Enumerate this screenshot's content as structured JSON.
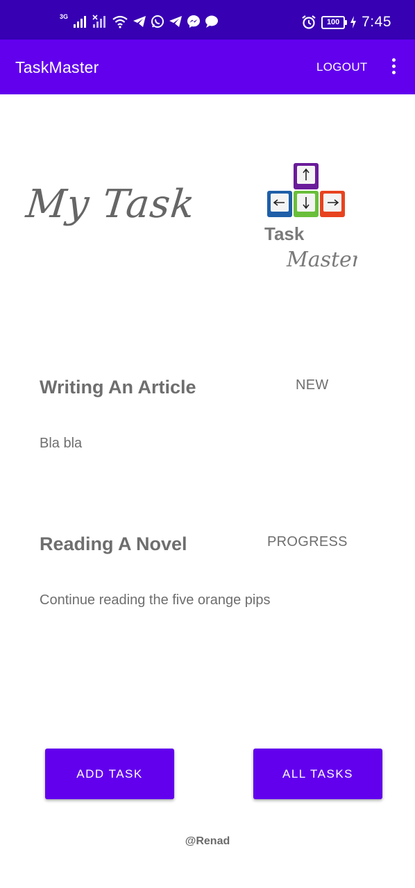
{
  "status_bar": {
    "network_label": "3G",
    "battery": "100",
    "time": "7:45",
    "icons": [
      "signal-icon",
      "no-signal-icon",
      "wifi-icon",
      "telegram-icon",
      "whatsapp-icon",
      "telegram-icon",
      "messenger-icon",
      "chat-icon",
      "alarm-icon",
      "battery-icon",
      "charging-icon"
    ]
  },
  "app_bar": {
    "title": "TaskMaster",
    "logout_label": "LOGOUT",
    "overflow_icon": "more-vert-icon"
  },
  "header": {
    "heading": "My Task",
    "logo": {
      "word1": "Task",
      "word2": "Master"
    }
  },
  "tasks": [
    {
      "title": "Writing An Article",
      "state": "NEW",
      "body": "Bla bla"
    },
    {
      "title": "Reading A Novel",
      "state": "PROGRESS",
      "body": "Continue reading the five orange pips"
    }
  ],
  "buttons": {
    "add_task": "ADD TASK",
    "all_tasks": "ALL TASKS"
  },
  "footer": "@Renad",
  "colors": {
    "status_bar": "#3700b3",
    "app_bar": "#6200ee",
    "button": "#6200ee",
    "text": "#6e6e6e"
  }
}
